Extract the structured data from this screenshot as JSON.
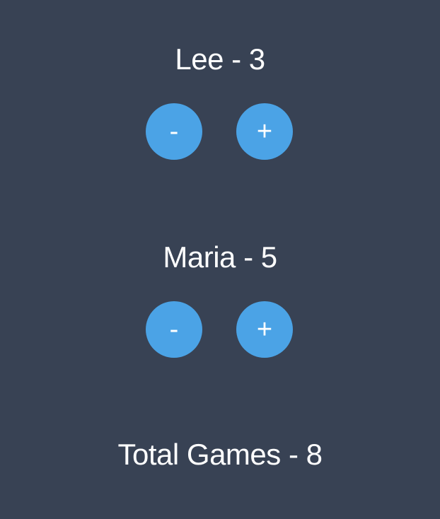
{
  "players": [
    {
      "name": "Lee",
      "score": "3",
      "label": "Lee - 3",
      "decrement_label": "-",
      "increment_label": "+"
    },
    {
      "name": "Maria",
      "score": "5",
      "label": "Maria - 5",
      "decrement_label": "-",
      "increment_label": "+"
    }
  ],
  "total": {
    "label": "Total Games - 8",
    "value": "8"
  },
  "colors": {
    "background": "#384254",
    "button": "#4ba3e6",
    "text": "#ffffff"
  }
}
